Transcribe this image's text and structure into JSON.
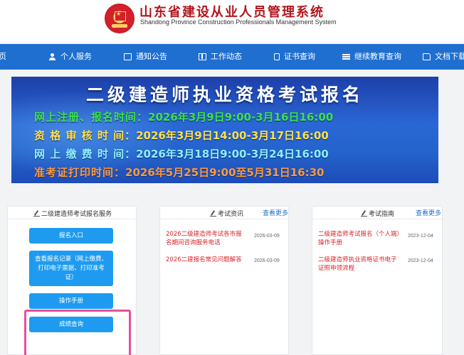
{
  "header": {
    "title": "山东省建设从业人员管理系统",
    "subtitle": "Shandong Province Construction Professionals Management System"
  },
  "nav": {
    "items": [
      {
        "label": "页",
        "icon": "home-icon"
      },
      {
        "label": "个人服务",
        "icon": "user-icon"
      },
      {
        "label": "通知公告",
        "icon": "document-icon"
      },
      {
        "label": "工作动态",
        "icon": "book-icon"
      },
      {
        "label": "证书查询",
        "icon": "phone-icon"
      },
      {
        "label": "继续教育查询",
        "icon": "list-icon"
      },
      {
        "label": "文档下载",
        "icon": "folder-icon"
      }
    ]
  },
  "banner": {
    "title": "二级建造师执业资格考试报名",
    "lines": [
      {
        "label": "网上注册、报名时间：",
        "value": "2026年3月9日9:00-3月16日16:00",
        "color": "#3ee24a"
      },
      {
        "label": "资 格 审 核 时 间：",
        "value": "2026年3月9日14:00-3月17日16:00",
        "color": "#ffe14a"
      },
      {
        "label": "网 上 缴 费 时 间：",
        "value": "2026年3月18日9:00-3月24日16:00",
        "color": "#8ff0ff"
      },
      {
        "label": "准考证打印时间：",
        "value": "2026年5月25日9:00至5月31日16:30",
        "color": "#ff9a3c"
      }
    ]
  },
  "service_card": {
    "title": "二级建造师考试报名服务",
    "buttons": [
      {
        "label": "报名入口"
      },
      {
        "label": "查看报名记录（网上缴费、打印电子票据、打印准考证）"
      },
      {
        "label": "操作手册"
      },
      {
        "label": "成绩查询"
      }
    ]
  },
  "news_card": {
    "title": "考试资讯",
    "more": "查看更多",
    "items": [
      {
        "text": "2026二级建造师考试各市报名期间咨询服务电话",
        "date": "2026-03-09"
      },
      {
        "text": "2026二建报名常见问题解答",
        "date": "2026-03-09"
      }
    ]
  },
  "guide_card": {
    "title": "考试指南",
    "more": "查看更多",
    "items": [
      {
        "text": "二级建造师考试报名（个人端）操作手册",
        "date": "2023-12-04"
      },
      {
        "text": "二级建造师执业资格证书电子证照申领流程",
        "date": "2023-12-04"
      }
    ]
  },
  "colors": {
    "nav": "#1f6fd0",
    "button": "#1e9bf0",
    "news": "#d9232a",
    "highlight": "#e6509b"
  }
}
